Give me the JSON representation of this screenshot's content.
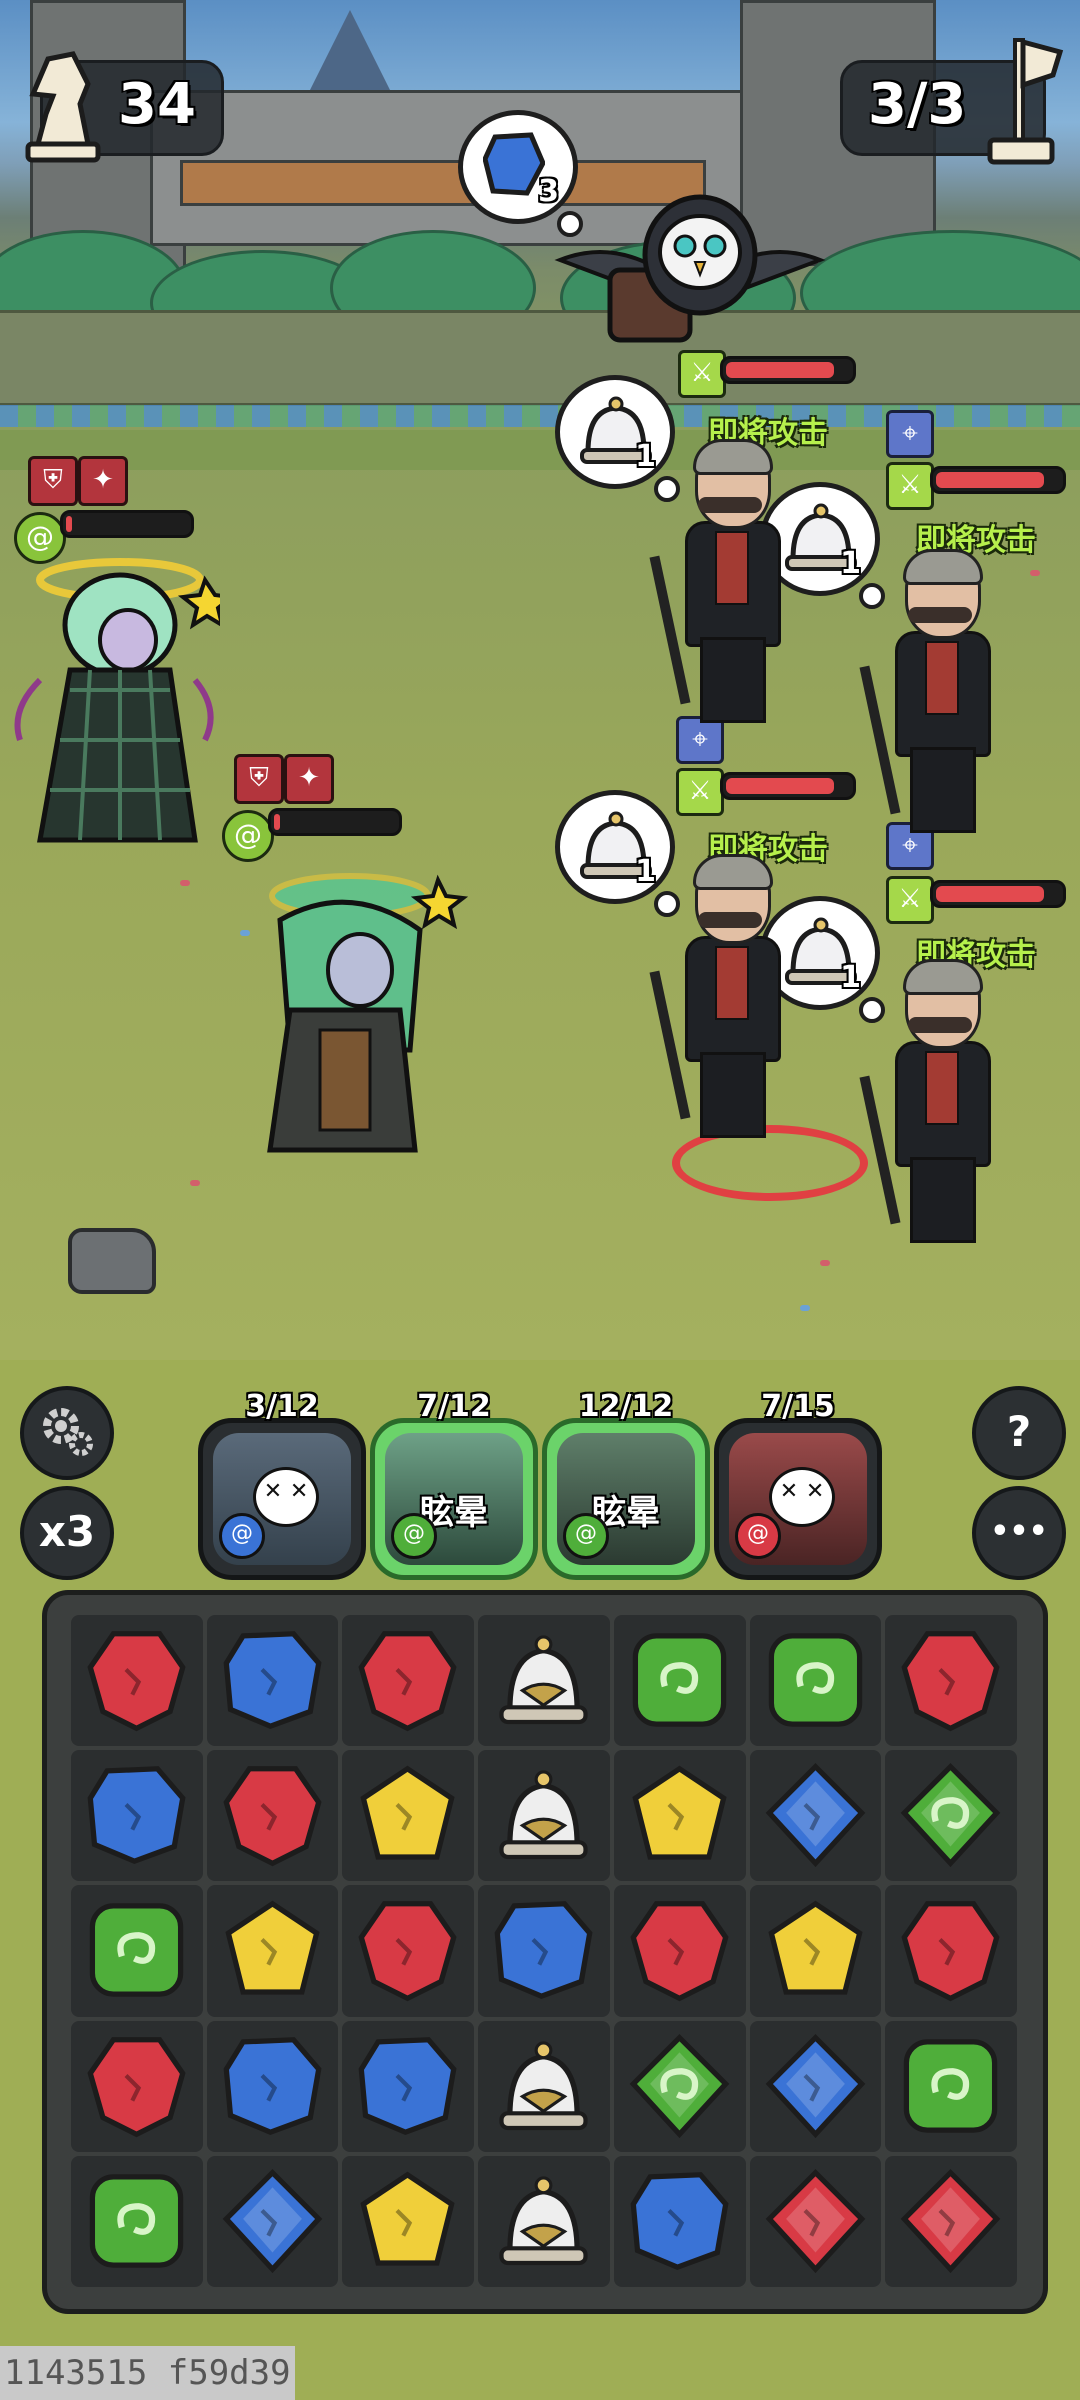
{
  "hud": {
    "moves_left": "34",
    "wave_progress": "3/3"
  },
  "gem_bubble": {
    "count": "3",
    "gem": "blue-stone"
  },
  "enemies": [
    {
      "name": "owl",
      "intent_label": "",
      "bubble_count": "",
      "hp_fraction": 0.9,
      "has_target": false
    },
    {
      "name": "gentleman-1",
      "intent_label": "即将攻击",
      "bubble_count": "1",
      "hp_fraction": 0.9,
      "has_target": false
    },
    {
      "name": "gentleman-2",
      "intent_label": "即将攻击",
      "bubble_count": "1",
      "hp_fraction": 0.9,
      "has_target": true
    },
    {
      "name": "gentleman-3",
      "intent_label": "即将攻击",
      "bubble_count": "1",
      "hp_fraction": 0.9,
      "has_target": true
    },
    {
      "name": "gentleman-4",
      "intent_label": "即将攻击",
      "bubble_count": "1",
      "hp_fraction": 0.9,
      "has_target": true
    }
  ],
  "heroes": [
    {
      "name": "green-witch",
      "hp_fraction": 0.02
    },
    {
      "name": "green-sage",
      "hp_fraction": 0.05
    }
  ],
  "cards": [
    {
      "count": "3/12",
      "status": "",
      "element": "blue",
      "ready": false
    },
    {
      "count": "7/12",
      "status": "眩晕",
      "element": "green",
      "ready": true
    },
    {
      "count": "12/12",
      "status": "眩晕",
      "element": "green",
      "ready": true
    },
    {
      "count": "7/15",
      "status": "",
      "element": "red",
      "ready": false
    }
  ],
  "controls": {
    "settings_icon": "gear-icon",
    "speed_label": "x3",
    "help_label": "?",
    "more_label": "•••"
  },
  "colors": {
    "red": "#d83a45",
    "blue": "#3a73d6",
    "yellow": "#f0cf3a",
    "green": "#4fae3a",
    "white": "#eeeeee",
    "hp": "#e34a4f",
    "intent": "#b6f04c"
  },
  "board": [
    [
      "red",
      "blue",
      "red",
      "bell",
      "green",
      "green",
      "red"
    ],
    [
      "blue",
      "red",
      "yellow",
      "bell",
      "yellow",
      "blue-diamond",
      "green-diamond"
    ],
    [
      "green",
      "yellow",
      "red",
      "blue",
      "red",
      "yellow",
      "red"
    ],
    [
      "red",
      "blue",
      "blue",
      "bell",
      "green-diamond",
      "blue-diamond",
      "green"
    ],
    [
      "green",
      "blue-diamond",
      "yellow",
      "bell",
      "blue",
      "red-diamond",
      "red-diamond"
    ]
  ],
  "debug_id": "1143515 f59d39"
}
